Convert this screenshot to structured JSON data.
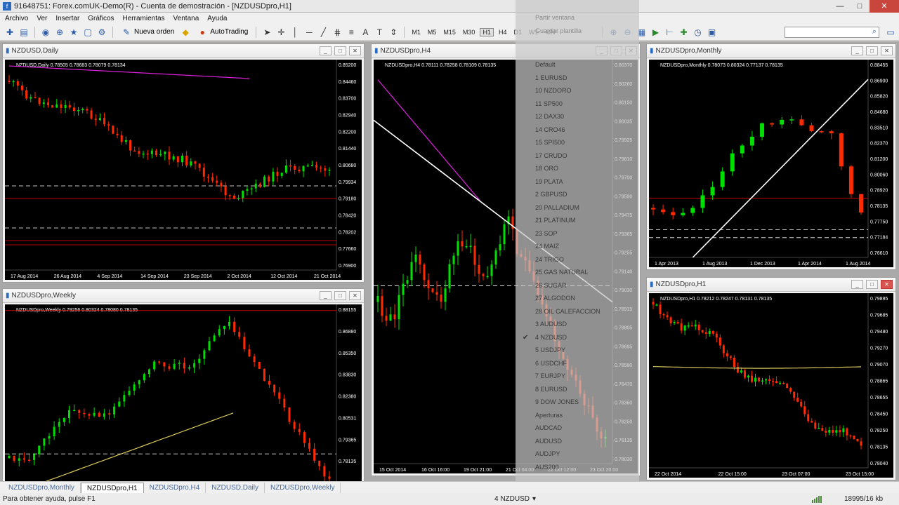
{
  "window": {
    "title": "91648751: Forex.comUK-Demo(R) - Cuenta de demostración - [NZDUSDpro,H1]",
    "minimize": "—",
    "maximize": "□",
    "close": "✕"
  },
  "menu": {
    "items": [
      {
        "label": "Archivo"
      },
      {
        "label": "Ver"
      },
      {
        "label": "Insertar"
      },
      {
        "label": "Gráficos"
      },
      {
        "label": "Herramientas"
      },
      {
        "label": "Ventana"
      },
      {
        "label": "Ayuda"
      }
    ]
  },
  "toolbar": {
    "new_order": "Nueva orden",
    "autotrading": "AutoTrading",
    "timeframes": [
      "M1",
      "M5",
      "M15",
      "M30",
      "H1",
      "H4",
      "D1",
      "W1",
      "MN"
    ],
    "active_timeframe": "H1"
  },
  "charts": [
    {
      "id": "daily",
      "window_title": "NZDUSD,Daily",
      "info": "NZDUSD,Daily  0.78505 0.78683 0.78079 0.78134",
      "price_labels": [
        "0.85200",
        "0.84460",
        "0.83700",
        "0.82940",
        "0.82200",
        "0.81440",
        "0.80680",
        "0.79934",
        "0.79180",
        "0.78420",
        "0.78202",
        "0.77660",
        "0.76900"
      ],
      "time_labels": [
        "17 Aug 2014",
        "26 Aug 2014",
        "4 Sep 2014",
        "14 Sep 2014",
        "23 Sep 2014",
        "2 Oct 2014",
        "12 Oct 2014",
        "21 Oct 2014"
      ],
      "seed": 11,
      "trend": "down-then-sideways",
      "ma_color": "#e020e0"
    },
    {
      "id": "h4",
      "window_title": "NZDUSDpro,H4",
      "info": "NZDUSDpro,H4  0.78111 0.78258 0.78109 0.78135",
      "price_labels": [
        "0.80370",
        "0.80260",
        "0.80150",
        "0.80035",
        "0.79925",
        "0.79810",
        "0.79700",
        "0.79590",
        "0.79475",
        "0.79365",
        "0.79255",
        "0.79140",
        "0.79030",
        "0.78915",
        "0.78805",
        "0.78695",
        "0.78580",
        "0.78470",
        "0.78360",
        "0.78250",
        "0.78135",
        "0.78030"
      ],
      "time_labels": [
        "15 Oct 2014",
        "16 Oct 16:00",
        "19 Oct 21:00",
        "21 Oct 04:00",
        "22 Oct 12:00",
        "23 Oct 20:00"
      ],
      "seed": 23
    },
    {
      "id": "monthly",
      "window_title": "NZDUSDpro,Monthly",
      "info": "NZDUSDpro,Monthly  0.78073 0.80324 0.77137 0.78135",
      "price_labels": [
        "0.88455",
        "0.86900",
        "0.85820",
        "0.84680",
        "0.83510",
        "0.82370",
        "0.81200",
        "0.80060",
        "0.78920",
        "0.78135",
        "0.77750",
        "0.77184",
        "0.76610"
      ],
      "time_labels": [
        "1 Apr 2013",
        "1 Aug 2013",
        "1 Dec 2013",
        "1 Apr 2014",
        "1 Aug 2014"
      ],
      "seed": 37
    },
    {
      "id": "weekly",
      "window_title": "NZDUSDpro,Weekly",
      "info": "NZDUSDpro,Weekly  0.79256 0.80324 0.78080 0.78135",
      "price_labels": [
        "0.88155",
        "0.86880",
        "0.85350",
        "0.83830",
        "0.82380",
        "0.80531",
        "0.79365",
        "0.78135",
        "0.77129",
        "0.76430"
      ],
      "time_labels": [
        "8 Sep 2013",
        "3 Nov 2013",
        "29 Dec 2013",
        "23 Feb 2014",
        "20 Apr 2014",
        "15 Jun 2014",
        "10 Aug 2014",
        "5 Oct 2014"
      ],
      "seed": 51,
      "ma_color": "#d8c85a"
    },
    {
      "id": "h1",
      "window_title": "NZDUSDpro,H1",
      "info": "NZDUSDpro,H1  0.78212 0.78247 0.78131 0.78135",
      "price_labels": [
        "0.79895",
        "0.79685",
        "0.79480",
        "0.79270",
        "0.79070",
        "0.78865",
        "0.78655",
        "0.78450",
        "0.78250",
        "0.78135",
        "0.78040"
      ],
      "time_labels": [
        "22 Oct 2014",
        "22 Oct 15:00",
        "23 Oct 07:00",
        "23 Oct 15:00"
      ],
      "seed": 67,
      "ma_color": "#d8c85a"
    }
  ],
  "dropdown": {
    "items": [
      {
        "label": "Partir ventana"
      },
      {
        "label": "Guardar plantilla"
      },
      {
        "label": "Default"
      },
      {
        "label": "1 EURUSD"
      },
      {
        "label": "10 NZDORO"
      },
      {
        "label": "11 SP500"
      },
      {
        "label": "12 DAX30"
      },
      {
        "label": "14 CRO46"
      },
      {
        "label": "15 SPI500"
      },
      {
        "label": "17 CRUDO"
      },
      {
        "label": "18 ORO"
      },
      {
        "label": "19 PLATA"
      },
      {
        "label": "2 GBPUSD"
      },
      {
        "label": "20 PALLADIUM"
      },
      {
        "label": "21 PLATINUM"
      },
      {
        "label": "23 SOP"
      },
      {
        "label": "24 MAIZ"
      },
      {
        "label": "24 TRIGO"
      },
      {
        "label": "25 GAS NATURAL"
      },
      {
        "label": "26 SUGAR"
      },
      {
        "label": "27 ALGODON"
      },
      {
        "label": "28 OIL CALEFACCION"
      },
      {
        "label": "3 AUDUSD"
      },
      {
        "label": "4 NZDUSD"
      },
      {
        "label": "5 USDJPY"
      },
      {
        "label": "6 USDCHF"
      },
      {
        "label": "7 EURJPY"
      },
      {
        "label": "8 EURUSD"
      },
      {
        "label": "9 DOW JONES"
      },
      {
        "label": "Aperturas"
      },
      {
        "label": "AUDCAD"
      },
      {
        "label": "AUDUSD"
      },
      {
        "label": "AUDJPY"
      },
      {
        "label": "AUS200"
      }
    ],
    "checked": "4 NZDUSD"
  },
  "tabs": [
    {
      "label": "NZDUSDpro,Monthly"
    },
    {
      "label": "NZDUSDpro,H1"
    },
    {
      "label": "NZDUSDpro,H4"
    },
    {
      "label": "NZDUSD,Daily"
    },
    {
      "label": "NZDUSDpro,Weekly"
    }
  ],
  "active_tab": "NZDUSDpro,H1",
  "status": {
    "help": "Para obtener ayuda, pulse F1",
    "profile": "4 NZDUSD",
    "traffic": "18995/16 kb"
  },
  "colors": {
    "bull": "#00e000",
    "bear": "#ff2a00",
    "chart_bg": "#000000",
    "trendline": "#ffffff",
    "hline": "#ff0000"
  }
}
